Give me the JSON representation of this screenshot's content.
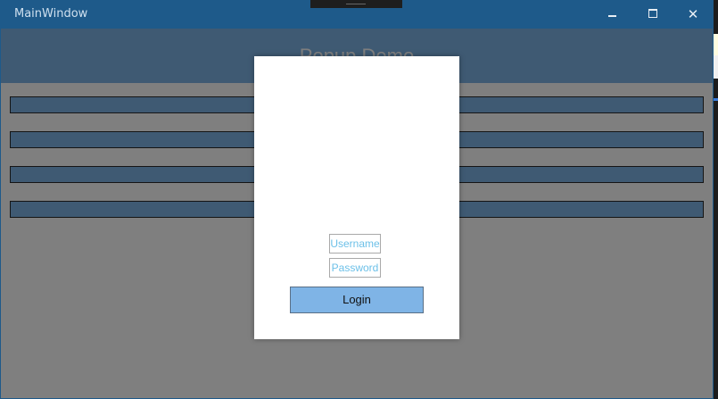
{
  "window": {
    "title": "MainWindow",
    "minimize_glyph": "",
    "close_glyph": "✕"
  },
  "header": {
    "title": "Popup Demo"
  },
  "fields": [
    {
      "value": ""
    },
    {
      "value": ""
    },
    {
      "value": ""
    },
    {
      "value": ""
    }
  ],
  "popup": {
    "username_placeholder": "Username",
    "password_placeholder": "Password",
    "login_label": "Login"
  },
  "colors": {
    "titlebar": "#1e5a8a",
    "accent": "#7fb4e6",
    "placeholder_text": "#6cc0e8",
    "overlay": "rgba(0,0,0,0.5)"
  },
  "icons": [
    "minimize-icon",
    "maximize-icon",
    "close-icon"
  ]
}
